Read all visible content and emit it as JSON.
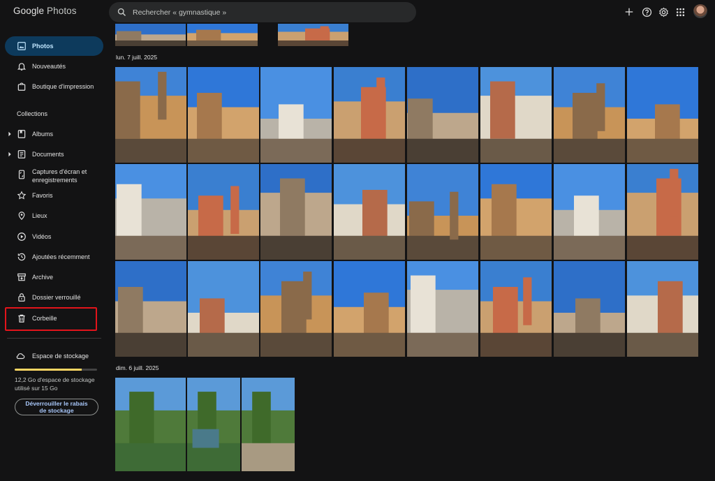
{
  "app": {
    "logo_google": "Google",
    "logo_photos": "Photos"
  },
  "search": {
    "placeholder": "Rechercher « gymnastique »",
    "icon": "search-icon"
  },
  "header_icons": [
    "add-icon",
    "help-icon",
    "settings-icon",
    "apps-grid-icon",
    "account-avatar"
  ],
  "sidebar": {
    "photos": "Photos",
    "updates": "Nouveautés",
    "print_store": "Boutique d'impression",
    "collections_title": "Collections",
    "albums": "Albums",
    "documents": "Documents",
    "screenshots_line1": "Captures d'écran et",
    "screenshots_line2": "enregistrements",
    "favorites": "Favoris",
    "places": "Lieux",
    "videos": "Vidéos",
    "recently_added": "Ajoutées récemment",
    "archive": "Archive",
    "locked_folder": "Dossier verrouillé",
    "trash": "Corbeille",
    "storage": "Espace de stockage",
    "storage_used_line1": "12,2 Go d'espace de stockage",
    "storage_used_line2": "utilisé sur 15 Go",
    "storage_fraction": 0.81,
    "unlock_line1": "Déverrouiller le rabais",
    "unlock_line2": "de stockage"
  },
  "colors": {
    "active_nav_bg": "#0d3a5c",
    "accent_link": "#a8c7fa",
    "storage_bar": "#fdd663",
    "highlight": "#e3141b"
  },
  "groups": [
    {
      "date": "lun. 7 juill. 2025",
      "photo_count": 24
    },
    {
      "date": "dim. 6 juill. 2025",
      "photo_count": 3
    }
  ]
}
